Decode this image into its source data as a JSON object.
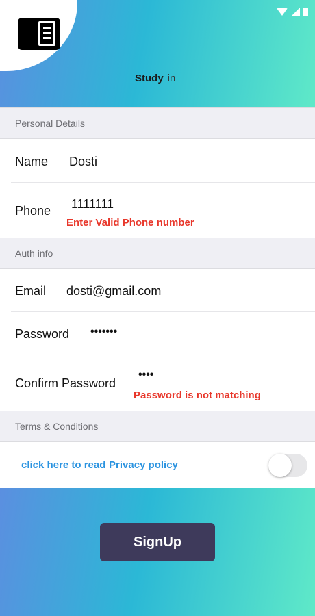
{
  "header": {
    "brand_bold": "Study",
    "brand_suffix": "in",
    "logo_icon": "sidebar-layout-icon",
    "gradient": [
      "#5b8fe0",
      "#2bb8d6",
      "#5fe9c8"
    ]
  },
  "status_bar": {
    "icons": [
      "wifi-icon",
      "signal-icon",
      "battery-icon"
    ]
  },
  "personal": {
    "section_title": "Personal Details",
    "name_label": "Name",
    "name_value": "Dosti",
    "phone_label": "Phone",
    "phone_value": "1111111",
    "phone_error": "Enter Valid Phone number"
  },
  "auth": {
    "section_title": "Auth info",
    "email_label": "Email",
    "email_value": "dosti@gmail.com",
    "password_label": "Password",
    "password_value": "•••••••",
    "confirm_label": "Confirm Password",
    "confirm_value": "••••",
    "confirm_error": "Password is not matching"
  },
  "terms": {
    "section_title": "Terms & Conditions",
    "link_read": "click here to read",
    "link_policy": "Privacy policy",
    "toggle_on": false
  },
  "actions": {
    "signup_label": "SignUp"
  },
  "colors": {
    "error": "#e8372b",
    "link": "#2a93e0",
    "button": "#3e3a5b"
  }
}
